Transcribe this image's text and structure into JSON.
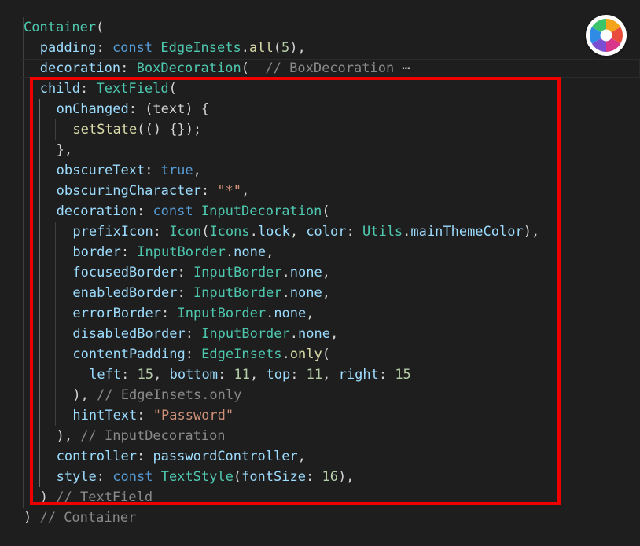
{
  "editor": {
    "lines": [
      {
        "indent": 0,
        "tokens": [
          {
            "c": "cls",
            "t": "Container"
          },
          {
            "c": "punc",
            "t": "("
          }
        ]
      },
      {
        "indent": 1,
        "tokens": [
          {
            "c": "prop",
            "t": "padding"
          },
          {
            "c": "punc",
            "t": ": "
          },
          {
            "c": "kw",
            "t": "const"
          },
          {
            "c": "punc",
            "t": " "
          },
          {
            "c": "cls",
            "t": "EdgeInsets"
          },
          {
            "c": "punc",
            "t": "."
          },
          {
            "c": "fn",
            "t": "all"
          },
          {
            "c": "punc",
            "t": "("
          },
          {
            "c": "num",
            "t": "5"
          },
          {
            "c": "punc",
            "t": "),"
          }
        ]
      },
      {
        "indent": 1,
        "tokens": [
          {
            "c": "prop",
            "t": "decoration"
          },
          {
            "c": "punc",
            "t": ": "
          },
          {
            "c": "cls",
            "t": "BoxDecoration"
          },
          {
            "c": "punc",
            "t": "(  "
          },
          {
            "c": "cmt",
            "t": "// BoxDecoration"
          },
          {
            "c": "fold",
            "t": " ⋯"
          }
        ]
      },
      {
        "indent": 1,
        "tokens": [
          {
            "c": "prop",
            "t": "child"
          },
          {
            "c": "punc",
            "t": ": "
          },
          {
            "c": "cls",
            "t": "TextField"
          },
          {
            "c": "punc",
            "t": "("
          }
        ]
      },
      {
        "indent": 2,
        "tokens": [
          {
            "c": "prop",
            "t": "onChanged"
          },
          {
            "c": "punc",
            "t": ": (text) {"
          }
        ]
      },
      {
        "indent": 3,
        "tokens": [
          {
            "c": "fn",
            "t": "setState"
          },
          {
            "c": "punc",
            "t": "(() {});"
          }
        ]
      },
      {
        "indent": 2,
        "tokens": [
          {
            "c": "punc",
            "t": "},"
          }
        ]
      },
      {
        "indent": 2,
        "tokens": [
          {
            "c": "prop",
            "t": "obscureText"
          },
          {
            "c": "punc",
            "t": ": "
          },
          {
            "c": "kw",
            "t": "true"
          },
          {
            "c": "punc",
            "t": ","
          }
        ]
      },
      {
        "indent": 2,
        "tokens": [
          {
            "c": "prop",
            "t": "obscuringCharacter"
          },
          {
            "c": "punc",
            "t": ": "
          },
          {
            "c": "str",
            "t": "\"*\""
          },
          {
            "c": "punc",
            "t": ","
          }
        ]
      },
      {
        "indent": 2,
        "tokens": [
          {
            "c": "prop",
            "t": "decoration"
          },
          {
            "c": "punc",
            "t": ": "
          },
          {
            "c": "kw",
            "t": "const"
          },
          {
            "c": "punc",
            "t": " "
          },
          {
            "c": "cls",
            "t": "InputDecoration"
          },
          {
            "c": "punc",
            "t": "("
          }
        ]
      },
      {
        "indent": 3,
        "tokens": [
          {
            "c": "prop",
            "t": "prefixIcon"
          },
          {
            "c": "punc",
            "t": ": "
          },
          {
            "c": "cls",
            "t": "Icon"
          },
          {
            "c": "punc",
            "t": "("
          },
          {
            "c": "cls",
            "t": "Icons"
          },
          {
            "c": "punc",
            "t": "."
          },
          {
            "c": "prop",
            "t": "lock"
          },
          {
            "c": "punc",
            "t": ", "
          },
          {
            "c": "prop",
            "t": "color"
          },
          {
            "c": "punc",
            "t": ": "
          },
          {
            "c": "cls",
            "t": "Utils"
          },
          {
            "c": "punc",
            "t": "."
          },
          {
            "c": "prop",
            "t": "mainThemeColor"
          },
          {
            "c": "punc",
            "t": "),"
          }
        ]
      },
      {
        "indent": 3,
        "tokens": [
          {
            "c": "prop",
            "t": "border"
          },
          {
            "c": "punc",
            "t": ": "
          },
          {
            "c": "cls",
            "t": "InputBorder"
          },
          {
            "c": "punc",
            "t": "."
          },
          {
            "c": "prop",
            "t": "none"
          },
          {
            "c": "punc",
            "t": ","
          }
        ]
      },
      {
        "indent": 3,
        "tokens": [
          {
            "c": "prop",
            "t": "focusedBorder"
          },
          {
            "c": "punc",
            "t": ": "
          },
          {
            "c": "cls",
            "t": "InputBorder"
          },
          {
            "c": "punc",
            "t": "."
          },
          {
            "c": "prop",
            "t": "none"
          },
          {
            "c": "punc",
            "t": ","
          }
        ]
      },
      {
        "indent": 3,
        "tokens": [
          {
            "c": "prop",
            "t": "enabledBorder"
          },
          {
            "c": "punc",
            "t": ": "
          },
          {
            "c": "cls",
            "t": "InputBorder"
          },
          {
            "c": "punc",
            "t": "."
          },
          {
            "c": "prop",
            "t": "none"
          },
          {
            "c": "punc",
            "t": ","
          }
        ]
      },
      {
        "indent": 3,
        "tokens": [
          {
            "c": "prop",
            "t": "errorBorder"
          },
          {
            "c": "punc",
            "t": ": "
          },
          {
            "c": "cls",
            "t": "InputBorder"
          },
          {
            "c": "punc",
            "t": "."
          },
          {
            "c": "prop",
            "t": "none"
          },
          {
            "c": "punc",
            "t": ","
          }
        ]
      },
      {
        "indent": 3,
        "tokens": [
          {
            "c": "prop",
            "t": "disabledBorder"
          },
          {
            "c": "punc",
            "t": ": "
          },
          {
            "c": "cls",
            "t": "InputBorder"
          },
          {
            "c": "punc",
            "t": "."
          },
          {
            "c": "prop",
            "t": "none"
          },
          {
            "c": "punc",
            "t": ","
          }
        ]
      },
      {
        "indent": 3,
        "tokens": [
          {
            "c": "prop",
            "t": "contentPadding"
          },
          {
            "c": "punc",
            "t": ": "
          },
          {
            "c": "cls",
            "t": "EdgeInsets"
          },
          {
            "c": "punc",
            "t": "."
          },
          {
            "c": "fn",
            "t": "only"
          },
          {
            "c": "punc",
            "t": "("
          }
        ]
      },
      {
        "indent": 4,
        "tokens": [
          {
            "c": "prop",
            "t": "left"
          },
          {
            "c": "punc",
            "t": ": "
          },
          {
            "c": "num",
            "t": "15"
          },
          {
            "c": "punc",
            "t": ", "
          },
          {
            "c": "prop",
            "t": "bottom"
          },
          {
            "c": "punc",
            "t": ": "
          },
          {
            "c": "num",
            "t": "11"
          },
          {
            "c": "punc",
            "t": ", "
          },
          {
            "c": "prop",
            "t": "top"
          },
          {
            "c": "punc",
            "t": ": "
          },
          {
            "c": "num",
            "t": "11"
          },
          {
            "c": "punc",
            "t": ", "
          },
          {
            "c": "prop",
            "t": "right"
          },
          {
            "c": "punc",
            "t": ": "
          },
          {
            "c": "num",
            "t": "15"
          }
        ]
      },
      {
        "indent": 3,
        "tokens": [
          {
            "c": "punc",
            "t": "), "
          },
          {
            "c": "cmt",
            "t": "// EdgeInsets.only"
          }
        ]
      },
      {
        "indent": 3,
        "tokens": [
          {
            "c": "prop",
            "t": "hintText"
          },
          {
            "c": "punc",
            "t": ": "
          },
          {
            "c": "str",
            "t": "\"Password\""
          }
        ]
      },
      {
        "indent": 2,
        "tokens": [
          {
            "c": "punc",
            "t": "), "
          },
          {
            "c": "cmt",
            "t": "// InputDecoration"
          }
        ]
      },
      {
        "indent": 2,
        "tokens": [
          {
            "c": "prop",
            "t": "controller"
          },
          {
            "c": "punc",
            "t": ": "
          },
          {
            "c": "prop",
            "t": "passwordController"
          },
          {
            "c": "punc",
            "t": ","
          }
        ]
      },
      {
        "indent": 2,
        "tokens": [
          {
            "c": "prop",
            "t": "style"
          },
          {
            "c": "punc",
            "t": ": "
          },
          {
            "c": "kw",
            "t": "const"
          },
          {
            "c": "punc",
            "t": " "
          },
          {
            "c": "cls",
            "t": "TextStyle"
          },
          {
            "c": "punc",
            "t": "("
          },
          {
            "c": "prop",
            "t": "fontSize"
          },
          {
            "c": "punc",
            "t": ": "
          },
          {
            "c": "num",
            "t": "16"
          },
          {
            "c": "punc",
            "t": "),"
          }
        ]
      },
      {
        "indent": 1,
        "tokens": [
          {
            "c": "punc",
            "t": ") "
          },
          {
            "c": "cmt",
            "t": "// TextField"
          }
        ]
      },
      {
        "indent": 0,
        "tokens": [
          {
            "c": "punc",
            "t": ") "
          },
          {
            "c": "cmt",
            "t": "// Container"
          }
        ]
      }
    ]
  },
  "annotation": {
    "color": "#ee0000"
  },
  "logo": {
    "icon": "color-wheel-icon"
  }
}
